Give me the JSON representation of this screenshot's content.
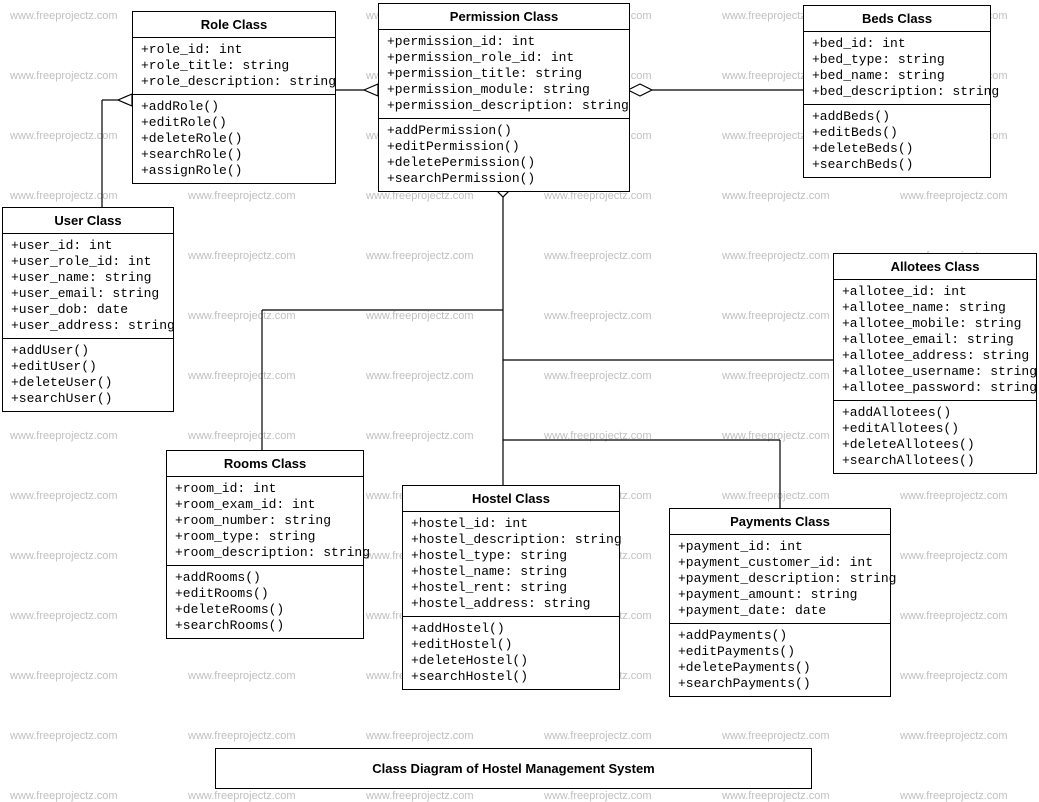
{
  "diagram_title": "Class Diagram of Hostel Management System",
  "watermark_text": "www.freeprojectz.com",
  "classes": {
    "role": {
      "name": "Role Class",
      "attrs": "+role_id: int\n+role_title: string\n+role_description: string",
      "ops": "+addRole()\n+editRole()\n+deleteRole()\n+searchRole()\n+assignRole()"
    },
    "permission": {
      "name": "Permission Class",
      "attrs": "+permission_id: int\n+permission_role_id: int\n+permission_title: string\n+permission_module: string\n+permission_description: string",
      "ops": "+addPermission()\n+editPermission()\n+deletePermission()\n+searchPermission()"
    },
    "beds": {
      "name": "Beds Class",
      "attrs": "+bed_id: int\n+bed_type: string\n+bed_name: string\n+bed_description: string",
      "ops": "+addBeds()\n+editBeds()\n+deleteBeds()\n+searchBeds()"
    },
    "user": {
      "name": "User Class",
      "attrs": "+user_id: int\n+user_role_id: int\n+user_name: string\n+user_email: string\n+user_dob: date\n+user_address: string",
      "ops": "+addUser()\n+editUser()\n+deleteUser()\n+searchUser()"
    },
    "allotees": {
      "name": "Allotees Class",
      "attrs": "+allotee_id: int\n+allotee_name: string\n+allotee_mobile: string\n+allotee_email: string\n+allotee_address: string\n+allotee_username: string\n+allotee_password: string",
      "ops": "+addAllotees()\n+editAllotees()\n+deleteAllotees()\n+searchAllotees()"
    },
    "rooms": {
      "name": "Rooms Class",
      "attrs": "+room_id: int\n+room_exam_id: int\n+room_number: string\n+room_type: string\n+room_description: string",
      "ops": "+addRooms()\n+editRooms()\n+deleteRooms()\n+searchRooms()"
    },
    "hostel": {
      "name": "Hostel Class",
      "attrs": "+hostel_id: int\n+hostel_description: string\n+hostel_type: string\n+hostel_name: string\n+hostel_rent: string\n+hostel_address: string",
      "ops": "+addHostel()\n+editHostel()\n+deleteHostel()\n+searchHostel()"
    },
    "payments": {
      "name": "Payments Class",
      "attrs": "+payment_id: int\n+payment_customer_id: int\n+payment_description: string\n+payment_amount: string\n+payment_date: date",
      "ops": "+addPayments()\n+editPayments()\n+deletePayments()\n+searchPayments()"
    }
  }
}
